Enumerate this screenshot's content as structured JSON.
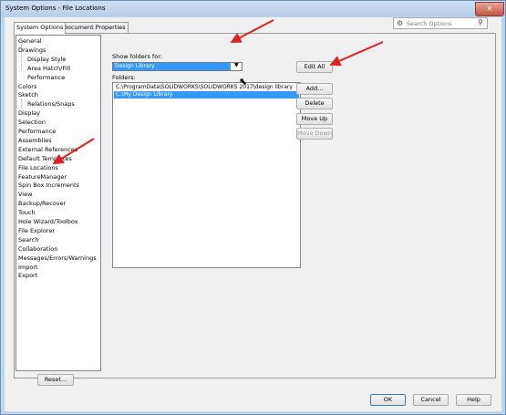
{
  "window": {
    "title": "System Options - File Locations",
    "close_glyph": "✕"
  },
  "tabs": [
    {
      "label": "System Options",
      "active": true
    },
    {
      "label": "Document Properties",
      "active": false
    }
  ],
  "search": {
    "placeholder": "Search Options",
    "icon": "gear-icon"
  },
  "nav": {
    "items": [
      {
        "label": "General",
        "indent": 0
      },
      {
        "label": "Drawings",
        "indent": 0
      },
      {
        "label": "Display Style",
        "indent": 1
      },
      {
        "label": "Area Hatch/Fill",
        "indent": 1
      },
      {
        "label": "Performance",
        "indent": 1
      },
      {
        "label": "Colors",
        "indent": 0
      },
      {
        "label": "Sketch",
        "indent": 0
      },
      {
        "label": "Relations/Snaps",
        "indent": 1
      },
      {
        "label": "Display",
        "indent": 0
      },
      {
        "label": "Selection",
        "indent": 0
      },
      {
        "label": "Performance",
        "indent": 0
      },
      {
        "label": "Assemblies",
        "indent": 0
      },
      {
        "label": "External References",
        "indent": 0
      },
      {
        "label": "Default Templates",
        "indent": 0
      },
      {
        "label": "File Locations",
        "indent": 0
      },
      {
        "label": "FeatureManager",
        "indent": 0
      },
      {
        "label": "Spin Box Increments",
        "indent": 0
      },
      {
        "label": "View",
        "indent": 0
      },
      {
        "label": "Backup/Recover",
        "indent": 0
      },
      {
        "label": "Touch",
        "indent": 0
      },
      {
        "label": "Hole Wizard/Toolbox",
        "indent": 0
      },
      {
        "label": "File Explorer",
        "indent": 0
      },
      {
        "label": "Search",
        "indent": 0
      },
      {
        "label": "Collaboration",
        "indent": 0
      },
      {
        "label": "Messages/Errors/Warnings",
        "indent": 0
      },
      {
        "label": "Import",
        "indent": 0
      },
      {
        "label": "Export",
        "indent": 0
      }
    ],
    "reset_label": "Reset..."
  },
  "main": {
    "show_folders_label": "Show folders for:",
    "show_folders_value": "Design Library",
    "folders_label": "Folders:",
    "folders": [
      {
        "path": "C:\\ProgramData\\SOLIDWORKS\\SOLIDWORKS 2017\\design library",
        "selected": false
      },
      {
        "path": "C:\\My Design Library",
        "selected": true
      }
    ],
    "buttons": {
      "edit_all": "Edit All",
      "add": "Add...",
      "delete": "Delete",
      "move_up": "Move Up",
      "move_down": "Move Down"
    }
  },
  "footer": {
    "ok": "OK",
    "cancel": "Cancel",
    "help": "Help"
  },
  "colors": {
    "selection": "#3399ff",
    "annotation_arrow": "#e02020"
  }
}
